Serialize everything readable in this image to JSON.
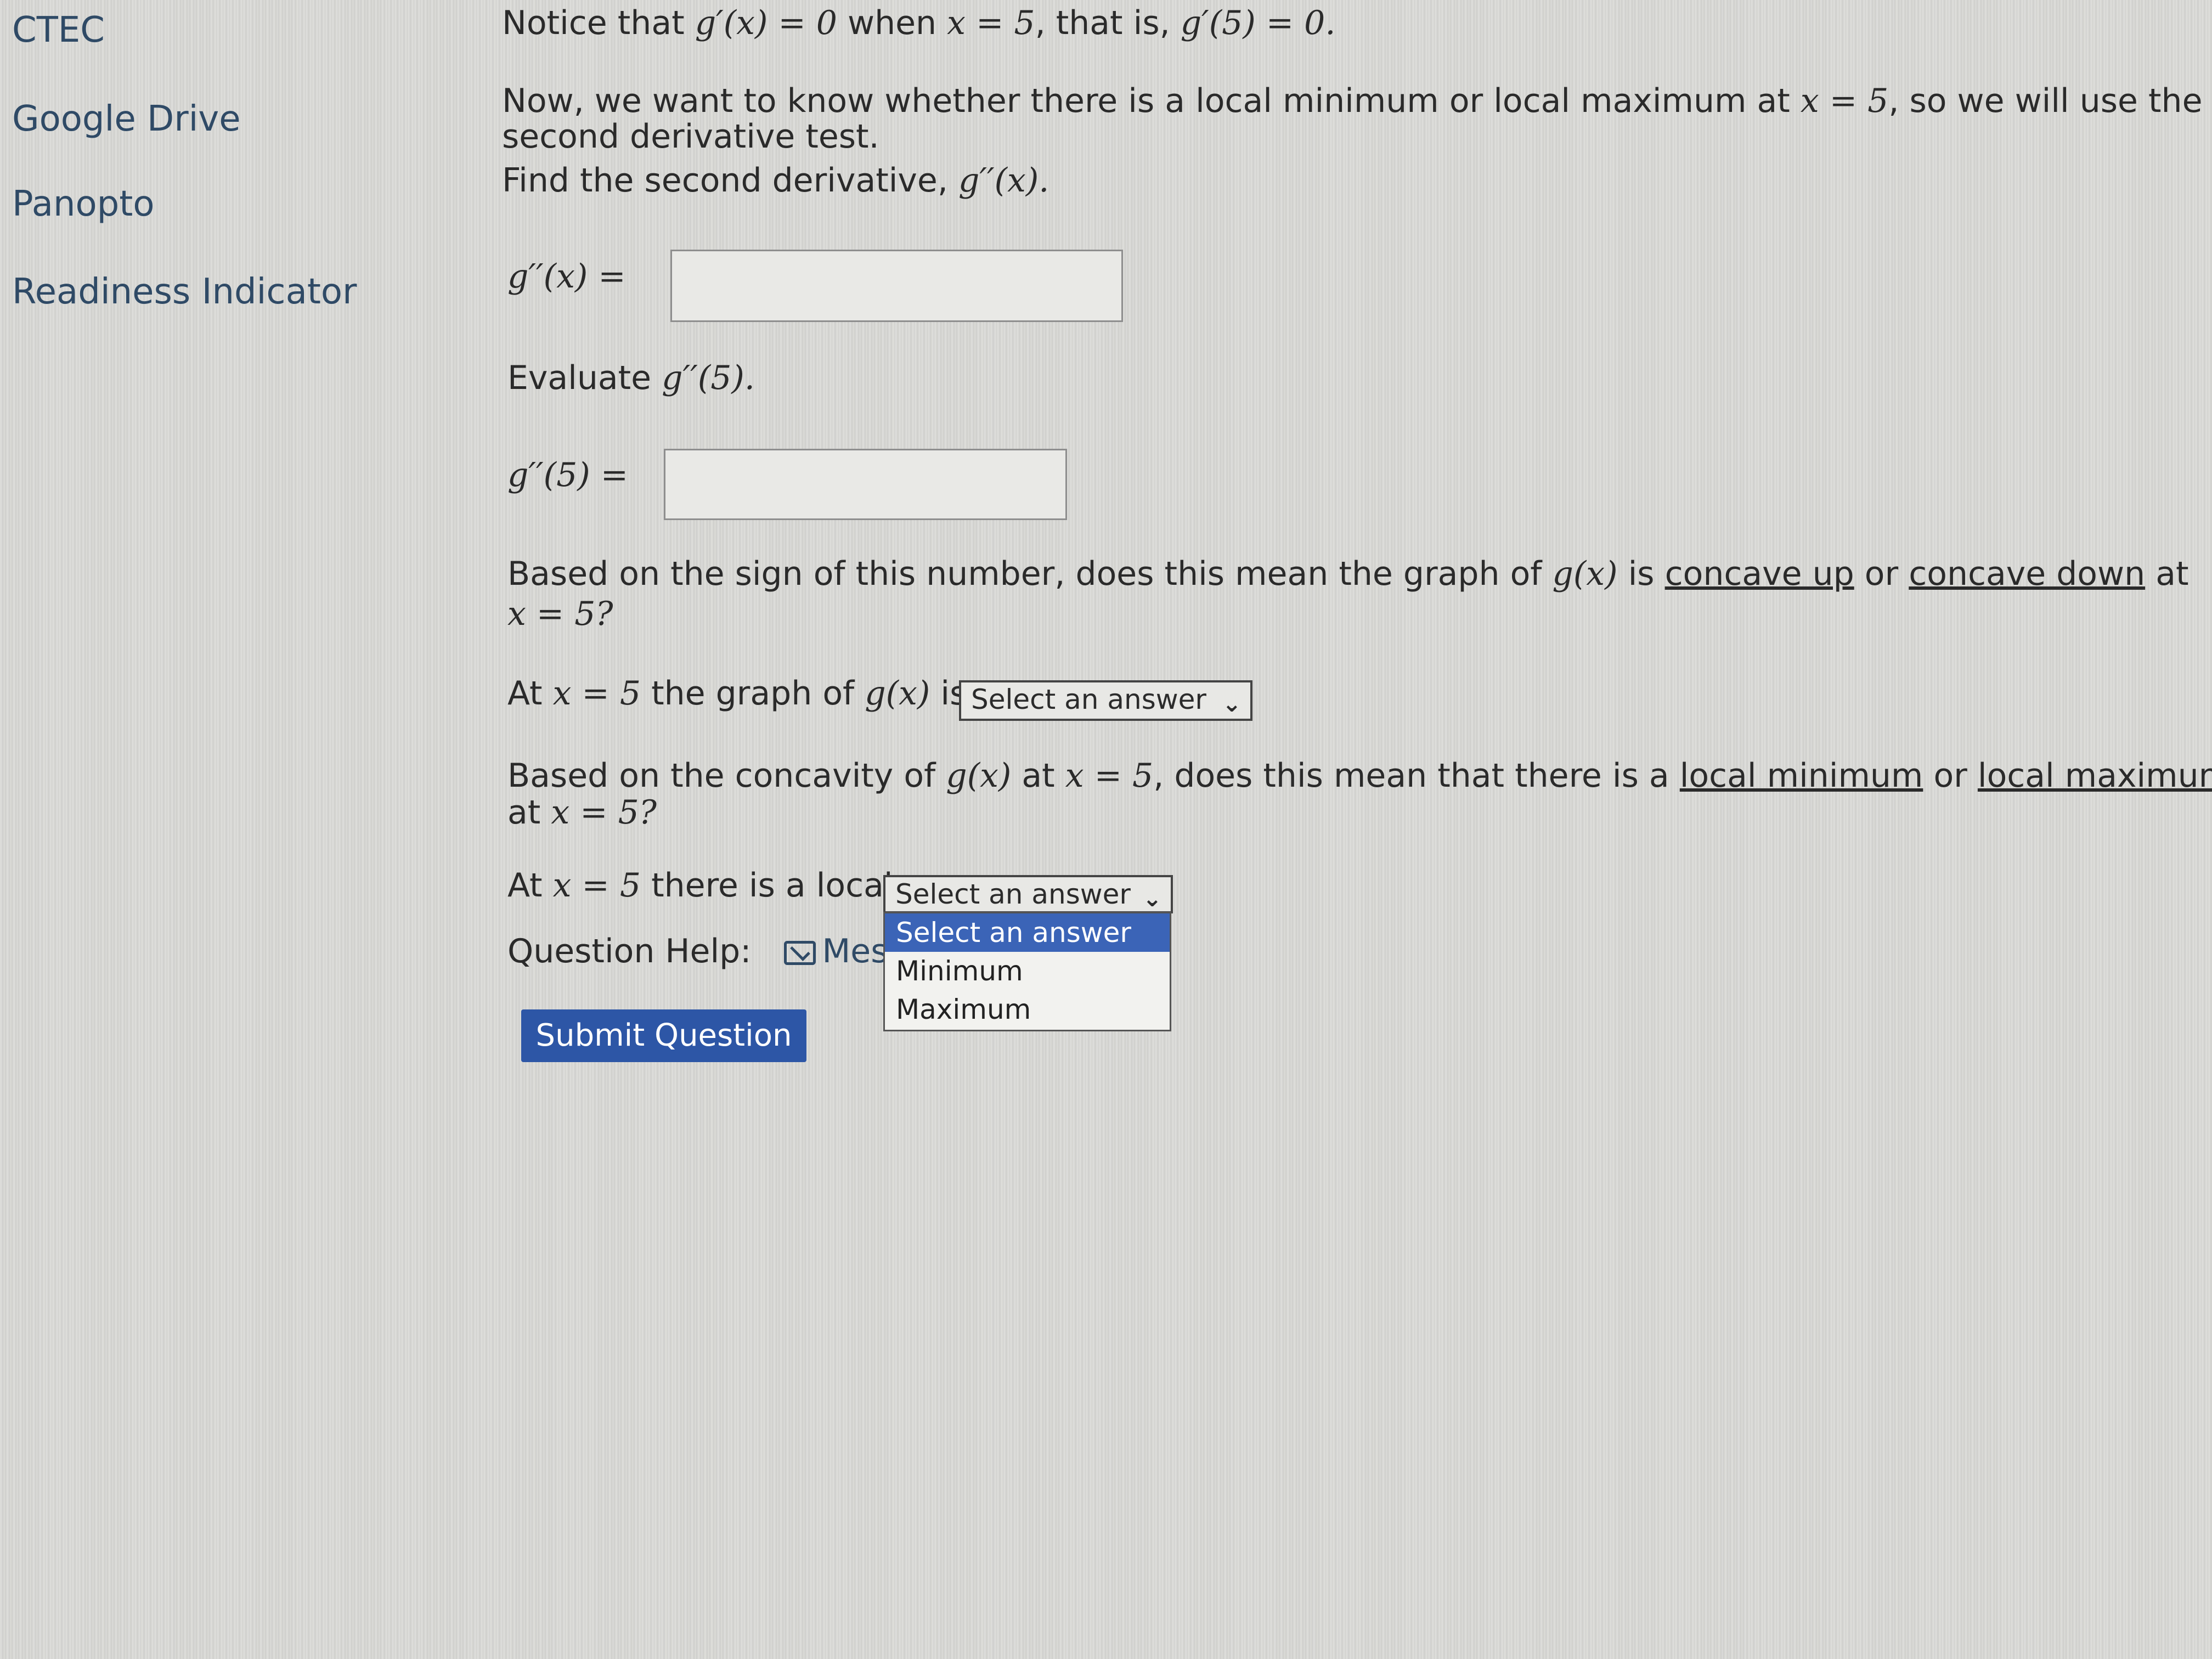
{
  "sidebar": {
    "items": [
      {
        "label": "CTEC"
      },
      {
        "label": "Google Drive"
      },
      {
        "label": "Panopto"
      },
      {
        "label": "Readiness Indicator"
      }
    ]
  },
  "question": {
    "notice": {
      "prefix": "Notice that ",
      "expr1": "g′(x) = 0",
      "mid": " when ",
      "expr2": "x = 5",
      "mid2": ", that is, ",
      "expr3": "g′(5) = 0."
    },
    "intro": {
      "line1_text": "Now, we want to know whether there is a local minimum or local maximum at ",
      "line1_math": "x = 5",
      "line1_tail": ", so we will use the",
      "line2": "second derivative test."
    },
    "find": {
      "text": "Find the second derivative, ",
      "math": "g′′(x)."
    },
    "second_deriv": {
      "label": "g′′(x) =",
      "value": ""
    },
    "evaluate": {
      "text": "Evaluate ",
      "math": "g′′(5)."
    },
    "eval_input": {
      "label": "g′′(5) =",
      "value": ""
    },
    "concavity_q": {
      "text1": "Based on the sign of this number, does this mean the graph of ",
      "math1": "g(x)",
      "text2": " is ",
      "link1": "concave up",
      "text3": " or ",
      "link2": "concave down",
      "text4": " at",
      "line2": "x = 5?"
    },
    "concavity_answer": {
      "prefix": "At ",
      "math": "x = 5",
      "mid": " the graph of ",
      "math2": "g(x)",
      "suffix": " is",
      "select_value": "Select an answer"
    },
    "extremum_q": {
      "text1": "Based on the concavity of ",
      "math1": "g(x)",
      "text2": " at ",
      "math2": "x = 5",
      "text3": ", does this mean that there is a ",
      "link1": "local minimum",
      "text4": " or ",
      "link2": "local maximum",
      "line2_prefix": "at ",
      "line2_math": "x = 5?"
    },
    "extremum_answer": {
      "prefix": "At ",
      "math": "x = 5",
      "suffix": " there is a local",
      "select_value": "Select an answer"
    },
    "dropdown_options": [
      "Select an answer",
      "Minimum",
      "Maximum"
    ],
    "help": {
      "label": "Question Help:",
      "message_label": "Messa"
    },
    "submit_label": "Submit Question"
  },
  "colors": {
    "link": "#2f4a66",
    "accent": "#2d56a6",
    "selected_option": "#3b64b7"
  },
  "icons": {
    "message": "mail-icon",
    "select": "chevron-down-icon"
  }
}
